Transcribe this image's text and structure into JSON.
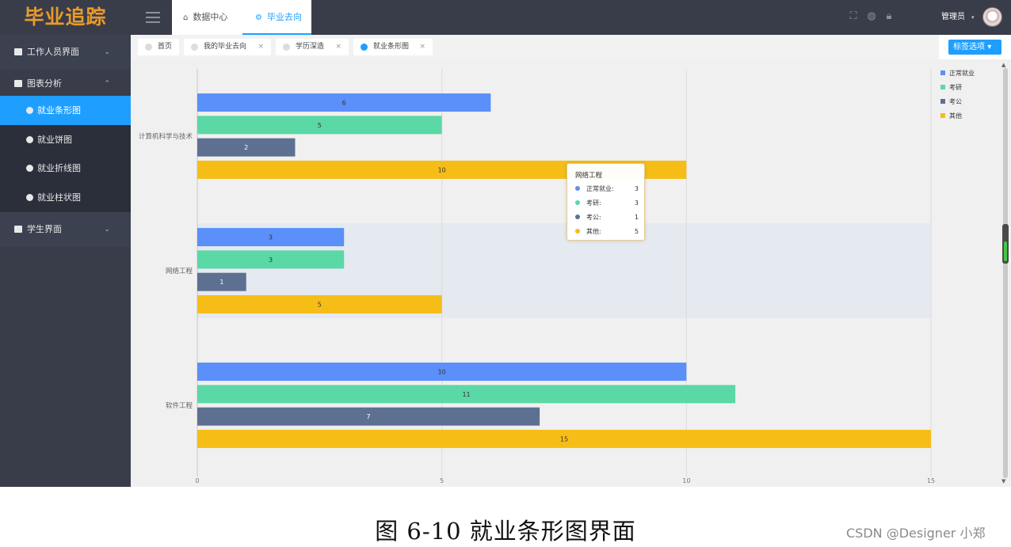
{
  "app": {
    "logo": "毕业追踪",
    "top_tabs": [
      {
        "label": "数据中心",
        "icon": "home-icon"
      },
      {
        "label": "毕业去向",
        "icon": "settings-icon"
      }
    ],
    "top_icons": [
      "fullscreen-icon",
      "globe-icon",
      "lock-icon"
    ],
    "user": {
      "name": "管理员",
      "caret": "▾"
    }
  },
  "sidebar": {
    "groups": [
      {
        "label": "工作人员界面",
        "chev": "⌄"
      },
      {
        "label": "图表分析",
        "chev": "⌃"
      },
      {
        "label": "学生界面",
        "chev": "⌄"
      }
    ],
    "sub_items": [
      {
        "label": "就业条形图",
        "active": true
      },
      {
        "label": "就业饼图"
      },
      {
        "label": "就业折线图"
      },
      {
        "label": "就业柱状图"
      }
    ]
  },
  "page_tabs": [
    {
      "label": "首页"
    },
    {
      "label": "我的毕业去向",
      "close": "×"
    },
    {
      "label": "学历深造",
      "close": "×"
    },
    {
      "label": "就业条形图",
      "close": "×",
      "active": true
    }
  ],
  "tag_options": {
    "label": "标签选项",
    "caret": "▾"
  },
  "chart_data": {
    "type": "bar",
    "orientation": "horizontal",
    "categories": [
      "计算机科学与技术",
      "网络工程",
      "软件工程"
    ],
    "series": [
      {
        "name": "正常就业",
        "color": "#5b8ff9",
        "values": [
          6,
          3,
          10
        ]
      },
      {
        "name": "考研",
        "color": "#5ad8a6",
        "values": [
          5,
          3,
          11
        ]
      },
      {
        "name": "考公",
        "color": "#5d7092",
        "values": [
          2,
          1,
          7
        ]
      },
      {
        "name": "其他",
        "color": "#f6bd16",
        "values": [
          10,
          5,
          15
        ]
      }
    ],
    "xlim": [
      0,
      15
    ],
    "xticks": [
      "0",
      "5",
      "10",
      "15"
    ],
    "grid": true,
    "legend_position": "top-right",
    "highlighted_category": "网络工程"
  },
  "tooltip": {
    "title": "网络工程",
    "rows": [
      {
        "label": "正常就业:",
        "value": "3",
        "color": "#5b8ff9"
      },
      {
        "label": "考研:",
        "value": "3",
        "color": "#5ad8a6"
      },
      {
        "label": "考公:",
        "value": "1",
        "color": "#5d7092"
      },
      {
        "label": "其他:",
        "value": "5",
        "color": "#f6bd16"
      }
    ]
  },
  "caption": "图 6-10  就业条形图界面",
  "watermark": "CSDN @Designer 小郑"
}
